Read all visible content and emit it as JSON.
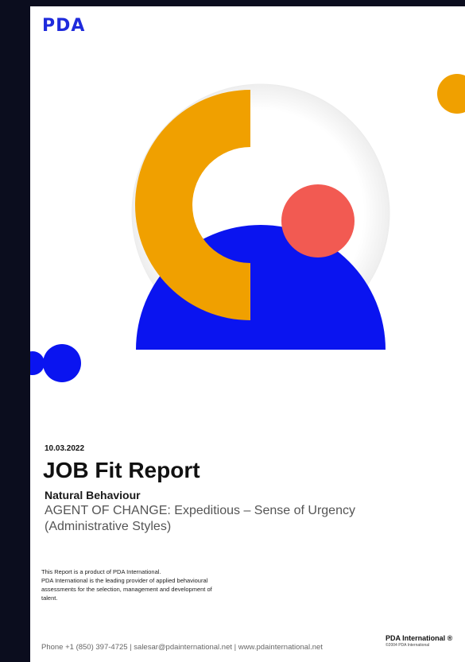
{
  "header": {
    "logo": "PDA"
  },
  "report": {
    "date": "10.03.2022",
    "title": "JOB Fit Report",
    "subtitle": "Natural Behaviour",
    "style_line1": "AGENT OF CHANGE: Expeditious – Sense of Urgency",
    "style_line2": "(Administrative Styles)"
  },
  "blurb": {
    "line1": "This Report is a product of PDA International.",
    "line2": "PDA International is the leading provider of applied behavioural",
    "line3": "assessments for the selection, management and development of",
    "line4": "talent."
  },
  "footer": {
    "contact": "Phone +1 (850) 397-4725 | salesar@pdainternational.net | www.pdainternational.net",
    "brand": "PDA International ®",
    "copyright": "©2004 PDA International"
  },
  "colors": {
    "blue": "#0a14f0",
    "orange": "#f0a000",
    "coral": "#f25a52",
    "logo": "#1f2bdc"
  }
}
